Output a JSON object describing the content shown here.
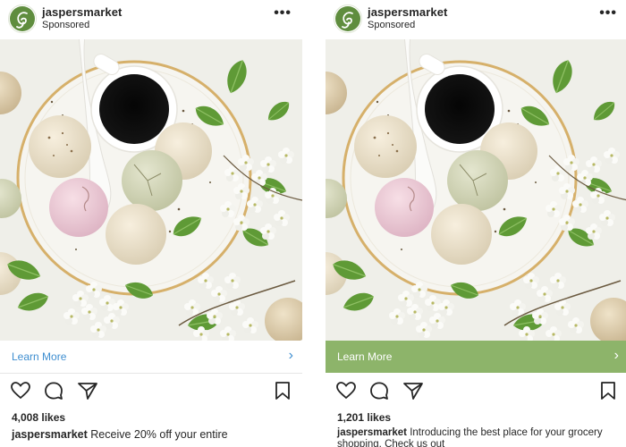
{
  "posts": [
    {
      "username": "jaspersmarket",
      "sponsored": "Sponsored",
      "more": "•••",
      "cta_label": "Learn More",
      "cta_chevron": "›",
      "likes": "4,008 likes",
      "caption_user": "jaspersmarket",
      "caption_text": "Receive 20% off your entire"
    },
    {
      "username": "jaspersmarket",
      "sponsored": "Sponsored",
      "more": "•••",
      "cta_label": "Learn More",
      "cta_chevron": "›",
      "likes": "1,201 likes",
      "caption_user": "jaspersmarket",
      "caption_text": "Introducing the best place for your grocery shopping. Check us out"
    }
  ],
  "icons": [
    "heart-icon",
    "comment-icon",
    "share-icon",
    "bookmark-icon",
    "more-dots-icon",
    "chevron-right-icon",
    "brand-logo-icon"
  ],
  "colors": {
    "cta_link_blue": "#3e8ed0",
    "cta_green": "#8db46a",
    "brand_green": "#5f8d3e",
    "text": "#262626"
  }
}
